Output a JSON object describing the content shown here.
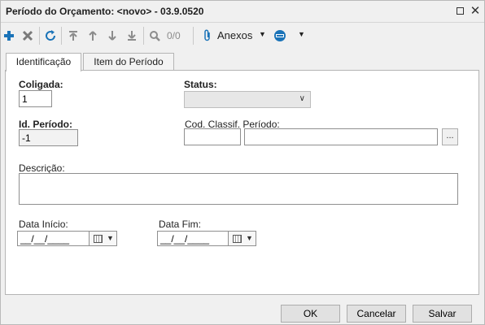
{
  "window": {
    "title": "Período do Orçamento: <novo> - 03.9.0520"
  },
  "toolbar": {
    "record_count": "0/0",
    "attachments_label": "Anexos",
    "icons": [
      "add-icon",
      "delete-icon",
      "refresh-icon",
      "first-record-icon",
      "previous-record-icon",
      "next-record-icon",
      "last-record-icon",
      "search-icon",
      "paperclip-icon",
      "window-menu-icon"
    ]
  },
  "tabs": [
    {
      "label": "Identificação"
    },
    {
      "label": "Item do Período"
    }
  ],
  "form": {
    "coligada": {
      "label": "Coligada:",
      "value": "1"
    },
    "status": {
      "label": "Status:",
      "value": ""
    },
    "id_periodo": {
      "label": "Id. Período:",
      "value": "-1"
    },
    "cod_classif": {
      "label": "Cod. Classif. Período:",
      "code_value": "",
      "desc_value": "",
      "lookup_label": "..."
    },
    "descricao": {
      "label": "Descrição:",
      "value": ""
    },
    "data_inicio": {
      "label": "Data Início:",
      "value": "__/__/____"
    },
    "data_fim": {
      "label": "Data Fim:",
      "value": "__/__/____"
    }
  },
  "buttons": {
    "ok": "OK",
    "cancel": "Cancelar",
    "save": "Salvar"
  },
  "colors": {
    "add_icon": "#1a73b8",
    "refresh_icon": "#1a73b8",
    "delete_icon": "#7a7a7a",
    "nav_icon": "#8c8c8c"
  }
}
